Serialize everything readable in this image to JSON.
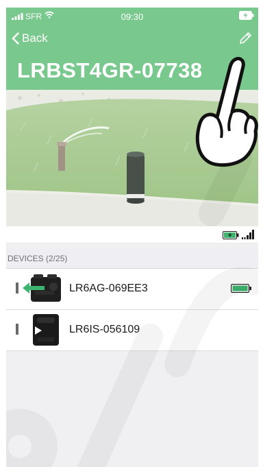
{
  "status_bar": {
    "carrier": "SFR",
    "time": "09:30"
  },
  "header": {
    "back_label": "Back",
    "title": "LRBST4GR-07738",
    "color": "#79c98f"
  },
  "devices_section": {
    "title": "DEVICES (2/25)"
  },
  "devices": [
    {
      "name": "LR6AG-069EE3",
      "battery_icon": "battery-full-icon",
      "accent": "#3db46d"
    },
    {
      "name": "LR6IS-056109"
    }
  ]
}
